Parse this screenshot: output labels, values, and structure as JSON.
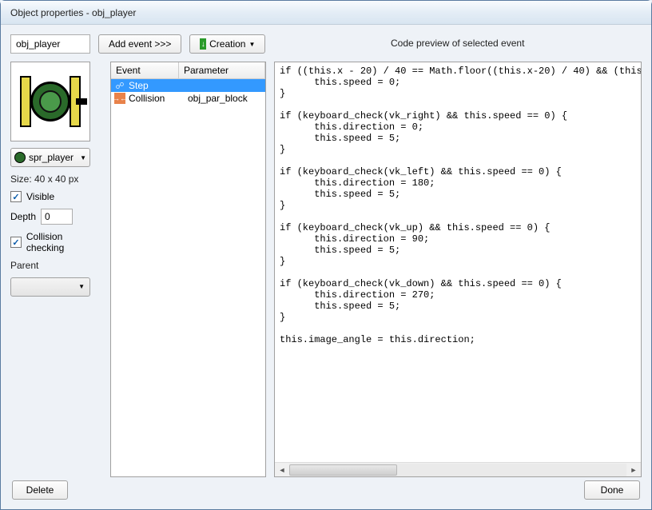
{
  "window": {
    "title": "Object properties - obj_player"
  },
  "object_name": "obj_player",
  "toolbar": {
    "add_event_label": "Add event >>>",
    "creation_label": "Creation"
  },
  "preview_header": "Code preview of selected event",
  "sprite": {
    "name": "spr_player",
    "size_label": "Size: 40 x 40 px"
  },
  "properties": {
    "visible_label": "Visible",
    "visible_checked": true,
    "depth_label": "Depth",
    "depth_value": "0",
    "collision_label": "Collision checking",
    "collision_checked": true,
    "parent_label": "Parent",
    "parent_value": ""
  },
  "events": {
    "header_event": "Event",
    "header_param": "Parameter",
    "items": [
      {
        "icon": "step-icon",
        "name": "Step",
        "param": "",
        "selected": true
      },
      {
        "icon": "collision-icon",
        "name": "Collision",
        "param": "obj_par_block",
        "selected": false
      }
    ]
  },
  "code": "if ((this.x - 20) / 40 == Math.floor((this.x-20) / 40) && (this.y\n      this.speed = 0;\n}\n\nif (keyboard_check(vk_right) && this.speed == 0) {\n      this.direction = 0;\n      this.speed = 5;\n}\n\nif (keyboard_check(vk_left) && this.speed == 0) {\n      this.direction = 180;\n      this.speed = 5;\n}\n\nif (keyboard_check(vk_up) && this.speed == 0) {\n      this.direction = 90;\n      this.speed = 5;\n}\n\nif (keyboard_check(vk_down) && this.speed == 0) {\n      this.direction = 270;\n      this.speed = 5;\n}\n\nthis.image_angle = this.direction;",
  "buttons": {
    "delete": "Delete",
    "done": "Done"
  }
}
